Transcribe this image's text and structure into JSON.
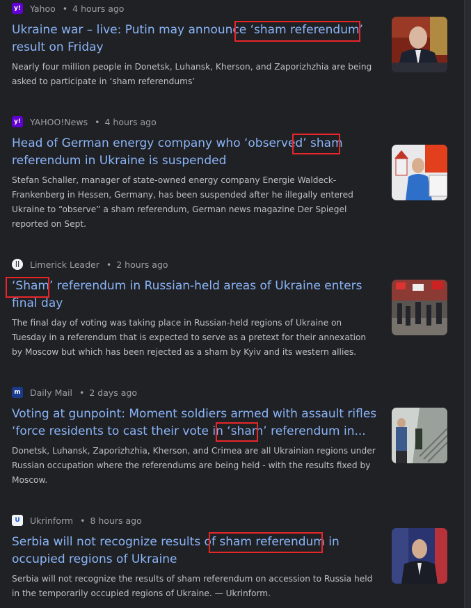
{
  "results": [
    {
      "source": "Yahoo",
      "source_icon": "yahoo-icon",
      "age": "4 hours ago",
      "title": "Ukraine war – live: Putin may announce ‘sham referendum’ result on Friday",
      "snippet": "Nearly four million people in Donetsk, Luhansk, Kherson, and Zaporizhzhia are being asked to participate in ‘sham referendums’",
      "thumbnail": "putin-at-desk-thumbnail"
    },
    {
      "source": "YAHOO!News",
      "source_icon": "yahoo-icon",
      "age": "4 hours ago",
      "title": "Head of German energy company who ‘observed’ sham referendum in Ukraine is suspended",
      "snippet": "Stefan Schaller, manager of state-owned energy company Energie Waldeck-Frankenberg in Hessen, Germany, has been suspended after he illegally entered Ukraine to “observe” a sham referendum, German news magazine Der Spiegel reported on Sept.",
      "thumbnail": "man-at-ballot-box-thumbnail"
    },
    {
      "source": "Limerick Leader",
      "source_icon": "limerick-leader-icon",
      "age": "2 hours ago",
      "title": "‘Sham’ referendum in Russian-held areas of Ukraine enters final day",
      "snippet": "The final day of voting was taking place in Russian-held regions of Ukraine on Tuesday in a referendum that is expected to serve as a pretext for their annexation by Moscow but which has been rejected as a sham by Kyiv and its western allies.",
      "thumbnail": "street-crowd-flags-thumbnail"
    },
    {
      "source": "Daily Mail",
      "source_icon": "daily-mail-icon",
      "age": "2 days ago",
      "title": "Voting at gunpoint: Moment soldiers armed with assault rifles ‘force residents to cast their vote in ‘sham’ referendum in...",
      "snippet": "Donetsk, Luhansk, Zaporizhzhia, Kherson, and Crimea are all Ukrainian regions under Russian occupation where the referendums are being held - with the results fixed by Moscow.",
      "thumbnail": "soldiers-stairwell-thumbnail"
    },
    {
      "source": "Ukrinform",
      "source_icon": "ukrinform-icon",
      "age": "8 hours ago",
      "title": "Serbia will not recognize results of sham referendum in occupied regions of Ukraine",
      "snippet": "Serbia will not recognize the results of sham referendum on accession to Russia held in the temporarily occupied regions of Ukraine. — Ukrinform.",
      "thumbnail": "serbian-official-thumbnail"
    }
  ],
  "colors": {
    "background": "#202124",
    "title_link": "#8ab4f8",
    "snippet_text": "#bdc1c6",
    "meta_text": "#9aa0a6",
    "highlight_box": "#e8262a"
  }
}
